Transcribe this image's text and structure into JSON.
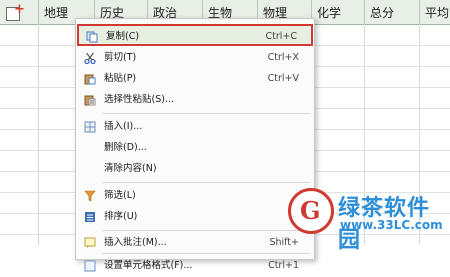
{
  "sheet": {
    "headers": [
      "地理",
      "历史",
      "政治",
      "生物",
      "物理",
      "化学",
      "总分",
      "平均"
    ]
  },
  "menu": {
    "items": [
      {
        "label": "复制(C)",
        "shortcut": "Ctrl+C"
      },
      {
        "label": "剪切(T)",
        "shortcut": "Ctrl+X"
      },
      {
        "label": "粘贴(P)",
        "shortcut": "Ctrl+V"
      },
      {
        "label": "选择性粘贴(S)...",
        "shortcut": ""
      },
      {
        "label": "插入(I)...",
        "shortcut": ""
      },
      {
        "label": "删除(D)...",
        "shortcut": ""
      },
      {
        "label": "清除内容(N)",
        "shortcut": ""
      },
      {
        "label": "筛选(L)",
        "shortcut": ""
      },
      {
        "label": "排序(U)",
        "shortcut": ""
      },
      {
        "label": "插入批注(M)...",
        "shortcut": "Shift+"
      },
      {
        "label": "设置单元格格式(F)...",
        "shortcut": "Ctrl+1"
      }
    ],
    "highlight_color": "#cf3a33"
  },
  "watermark": {
    "logo_letter": "G",
    "title": "绿茶软件园",
    "url": "www.33LC.com"
  }
}
